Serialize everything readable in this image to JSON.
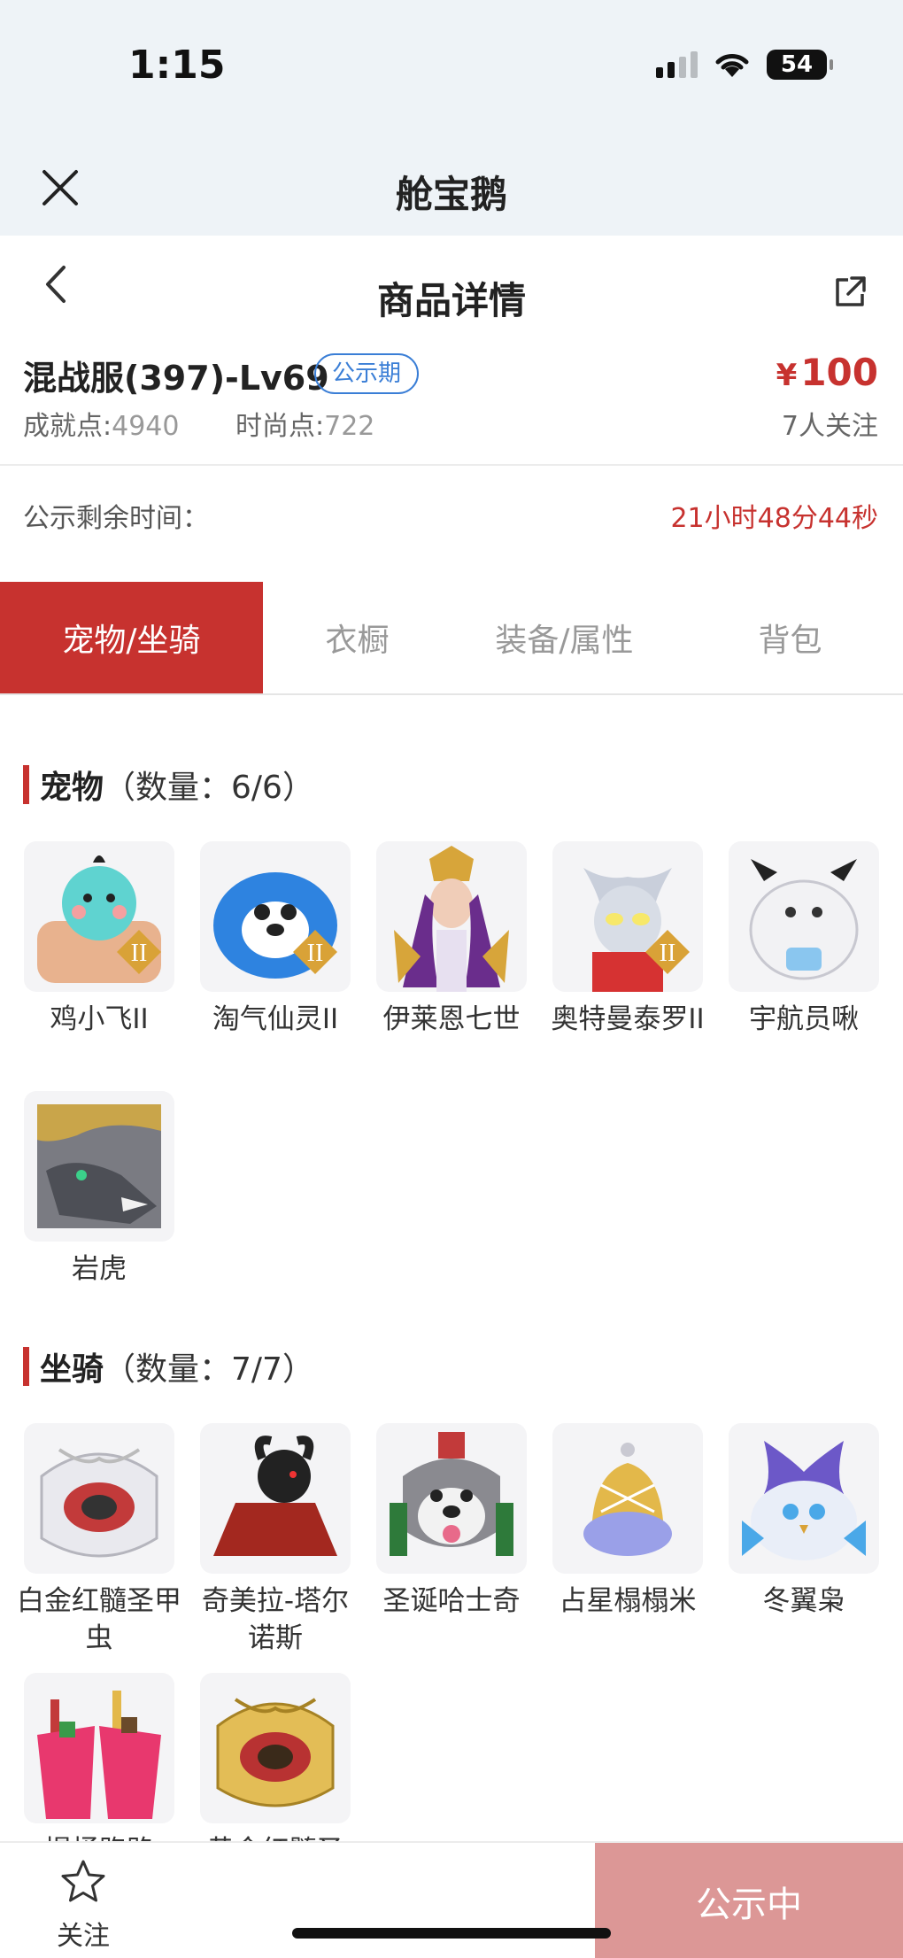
{
  "status_bar": {
    "time": "1:15",
    "battery": "54"
  },
  "app_bar": {
    "title": "舱宝鹅"
  },
  "header": {
    "title": "商品详情"
  },
  "product": {
    "name": "混战服(397)-Lv69",
    "badge": "公示期",
    "price_symbol": "¥",
    "price": "100",
    "achievement_label": "成就点:",
    "achievement_value": "4940",
    "fashion_label": "时尚点:",
    "fashion_value": "722",
    "followers": "7人关注"
  },
  "notice": {
    "label": "公示剩余时间：",
    "time": "21小时48分44秒"
  },
  "tabs": [
    {
      "label": "宠物/坐骑",
      "active": true
    },
    {
      "label": "衣橱"
    },
    {
      "label": "装备/属性"
    },
    {
      "label": "背包"
    }
  ],
  "pets": {
    "title": "宠物",
    "count": "（数量：6/6）",
    "items": [
      {
        "name": "鸡小飞II",
        "icon": "chick-pet-icon"
      },
      {
        "name": "淘气仙灵II",
        "icon": "blue-dog-pet-icon"
      },
      {
        "name": "伊莱恩七世",
        "icon": "queen-pet-icon"
      },
      {
        "name": "奥特曼泰罗II",
        "icon": "ultraman-pet-icon"
      },
      {
        "name": "宇航员啾",
        "icon": "astronaut-pet-icon"
      },
      {
        "name": "岩虎",
        "icon": "wolf-pet-icon"
      }
    ]
  },
  "mounts": {
    "title": "坐骑",
    "count": "（数量：7/7）",
    "items": [
      {
        "name": "白金红髓圣甲虫",
        "icon": "silver-beetle-mount-icon"
      },
      {
        "name": "奇美拉-塔尔诺斯",
        "icon": "chimera-mount-icon"
      },
      {
        "name": "圣诞哈士奇",
        "icon": "husky-mount-icon"
      },
      {
        "name": "占星榻榻米",
        "icon": "astrology-mount-icon"
      },
      {
        "name": "冬翼枭",
        "icon": "owl-mount-icon"
      },
      {
        "name": "提桶跑路",
        "icon": "bucket-mount-icon"
      },
      {
        "name": "黄金红髓圣",
        "icon": "gold-beetle-mount-icon"
      }
    ]
  },
  "bottom": {
    "follow_label": "关注",
    "status_button": "公示中"
  },
  "colors": {
    "accent": "#c7322f",
    "badge": "#3a7ed6",
    "status_button": "#dc9796"
  }
}
